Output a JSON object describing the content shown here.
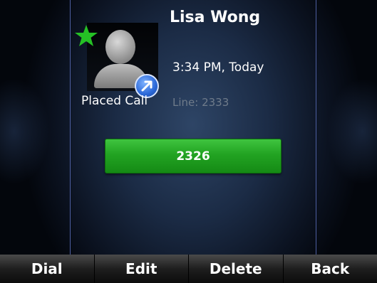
{
  "contact": {
    "name": "Lisa Wong",
    "time": "3:34 PM, Today",
    "line": "Line: 2333",
    "call_type": "Placed Call",
    "favorite_icon": "star-icon",
    "call_type_icon": "placed-call-arrow-icon"
  },
  "number_button": {
    "label": "2326",
    "color": "#22a322"
  },
  "softkeys": [
    {
      "label": "Dial"
    },
    {
      "label": "Edit"
    },
    {
      "label": "Delete"
    },
    {
      "label": "Back"
    }
  ]
}
